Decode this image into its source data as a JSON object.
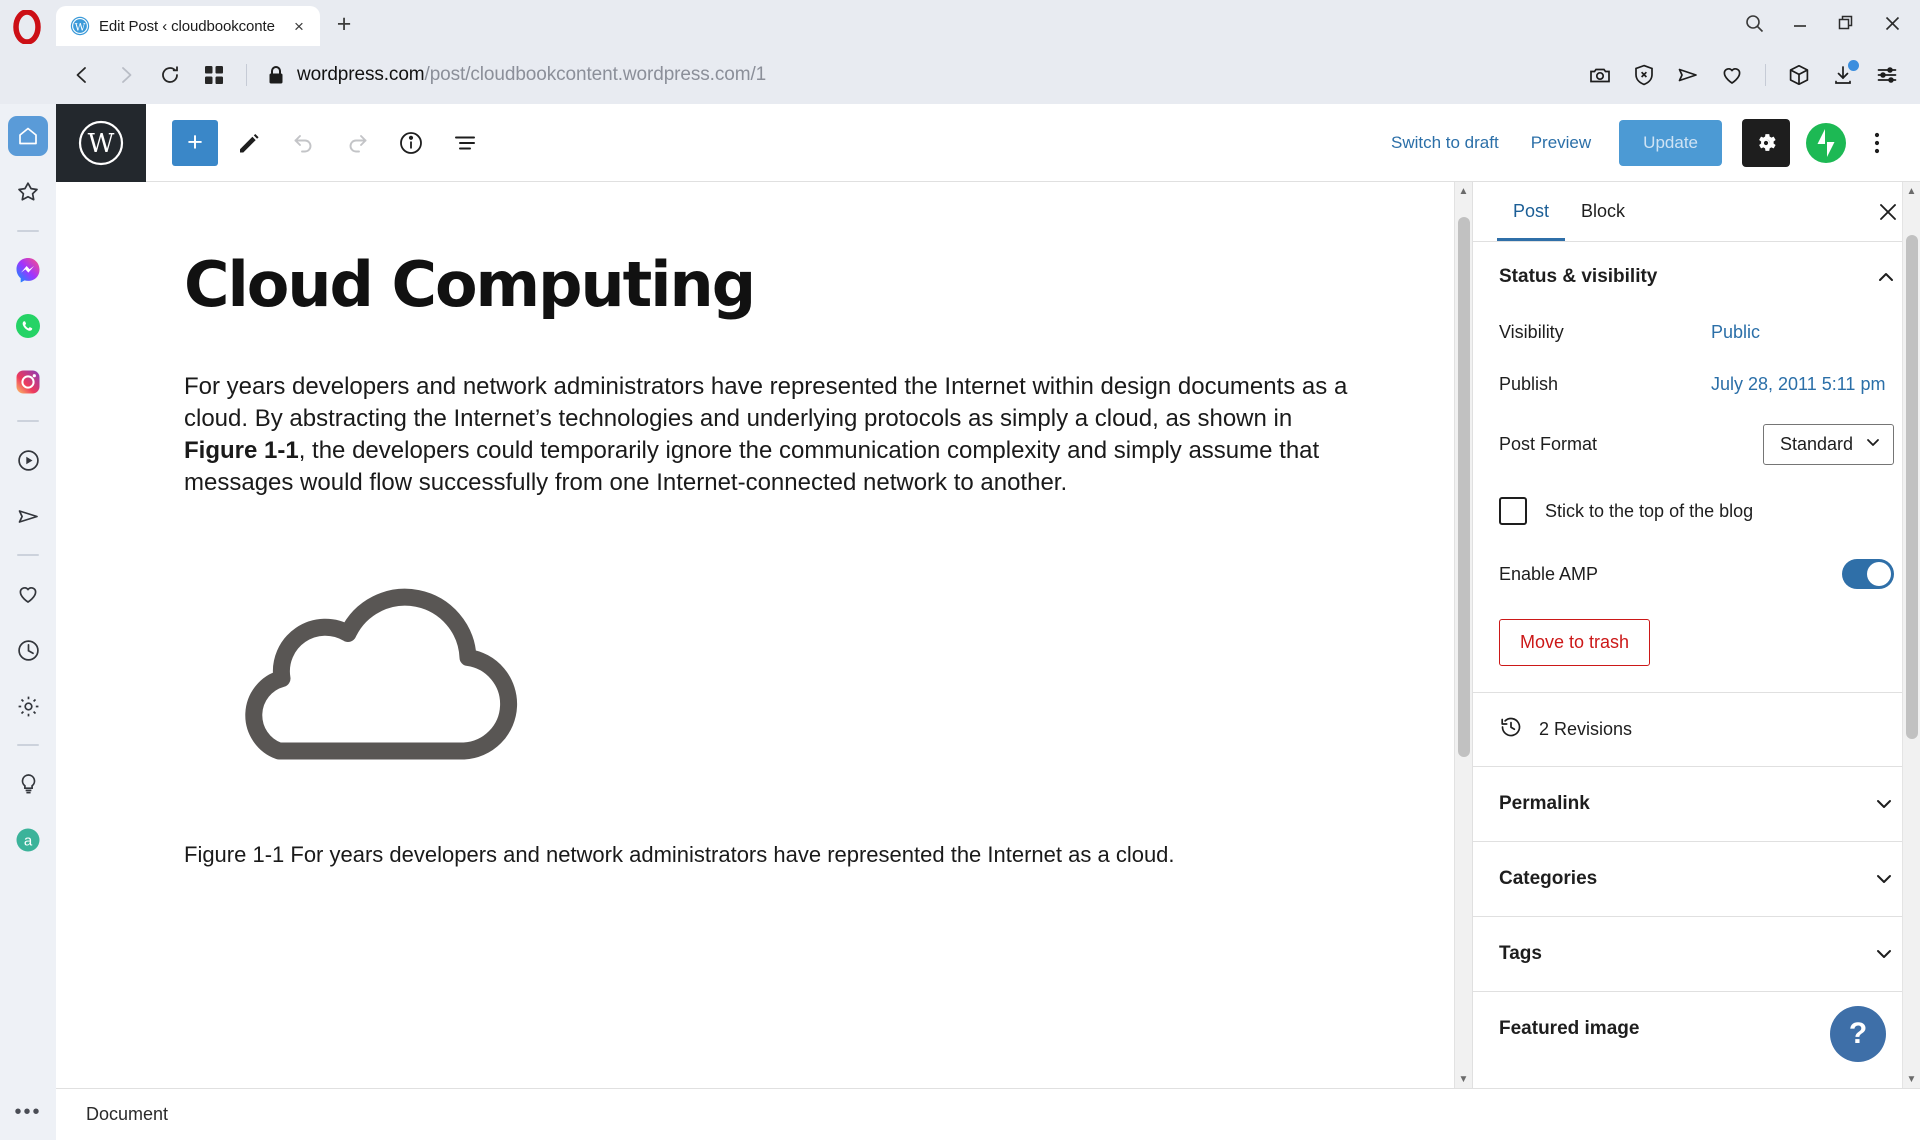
{
  "browser": {
    "tab": {
      "title": "Edit Post ‹ cloudbookconte",
      "favicon": "wordpress-icon",
      "close": "×"
    },
    "newtab_label": "+",
    "window_controls": {
      "search": "search-icon",
      "minimize": "minimize-icon",
      "restore": "restore-icon",
      "close": "close-icon"
    },
    "nav": {
      "back": "back-arrow-icon",
      "forward": "forward-arrow-icon",
      "reload": "reload-icon",
      "tabgrid": "tab-grid-icon",
      "lock": "lock-icon"
    },
    "url": {
      "host": "wordpress.com",
      "path": "/post/cloudbookcontent.wordpress.com/1"
    },
    "toolbar_icons": [
      "snapshot-camera-icon",
      "ad-blocker-shield-icon",
      "send-arrow-icon",
      "heart-icon",
      "workspaces-cube-icon",
      "downloads-icon",
      "easy-setup-sliders-icon"
    ]
  },
  "opera_sidebar": {
    "items": [
      {
        "name": "home-icon",
        "active": true
      },
      {
        "name": "favorites-star-icon",
        "active": false
      },
      {
        "name": "messenger-icon",
        "active": false
      },
      {
        "name": "whatsapp-icon",
        "active": false
      },
      {
        "name": "instagram-icon",
        "active": false
      },
      {
        "name": "player-icon",
        "active": false
      },
      {
        "name": "telegram-send-icon",
        "active": false
      },
      {
        "name": "pinboard-heart-icon",
        "active": false
      },
      {
        "name": "history-clock-icon",
        "active": false
      },
      {
        "name": "settings-gear-icon",
        "active": false
      },
      {
        "name": "tips-lightbulb-icon",
        "active": false
      },
      {
        "name": "aria-assistant-icon",
        "active": false
      }
    ],
    "more_label": "•••"
  },
  "editor_header": {
    "logo": "wordpress-logo",
    "add_block": "+",
    "tools": [
      "edit-pencil-icon",
      "undo-icon",
      "redo-icon",
      "info-icon",
      "list-view-icon"
    ],
    "switch_to_draft": "Switch to draft",
    "preview": "Preview",
    "update": "Update",
    "settings_gear": "settings-gear-icon",
    "jetpack": "jetpack-icon",
    "more": "more-options-icon"
  },
  "post": {
    "title": "Cloud Computing",
    "paragraph_part1": "For years developers and network administrators have represented the Internet within design documents as a cloud. By abstracting the Internet’s technologies and underlying protocols as simply a cloud, as shown in ",
    "paragraph_bold": "Figure 1-1",
    "paragraph_part2": ", the developers could temporarily ignore the communication complexity and simply assume that messages would flow successfully from one Internet-connected network to another.",
    "figure_alt": "cloud-outline-illustration",
    "figure_caption": "Figure 1-1 For years developers and network administrators have represented the Internet as a cloud."
  },
  "status_bar": {
    "breadcrumb": "Document"
  },
  "settings_sidebar": {
    "tabs": [
      {
        "label": "Post",
        "active": true
      },
      {
        "label": "Block",
        "active": false
      }
    ],
    "close": "×",
    "status_visibility": {
      "title": "Status & visibility",
      "expanded": true,
      "visibility_label": "Visibility",
      "visibility_value": "Public",
      "publish_label": "Publish",
      "publish_value": "July 28, 2011 5:11 pm",
      "post_format_label": "Post Format",
      "post_format_value": "Standard",
      "sticky_label": "Stick to the top of the blog",
      "sticky_checked": false,
      "amp_label": "Enable AMP",
      "amp_enabled": true,
      "trash_label": "Move to trash"
    },
    "revisions": {
      "icon": "revisions-clock-icon",
      "label": "2 Revisions"
    },
    "panels": [
      {
        "label": "Permalink",
        "expanded": false
      },
      {
        "label": "Categories",
        "expanded": false
      },
      {
        "label": "Tags",
        "expanded": false
      },
      {
        "label": "Featured image",
        "expanded": false
      }
    ],
    "help_label": "?"
  },
  "colors": {
    "accent_blue": "#2f6fa8",
    "update_blue": "#4c9ad4",
    "trash_red": "#cc1818",
    "jetpack_green": "#1db954",
    "chrome_bg": "#e8ebf1"
  }
}
